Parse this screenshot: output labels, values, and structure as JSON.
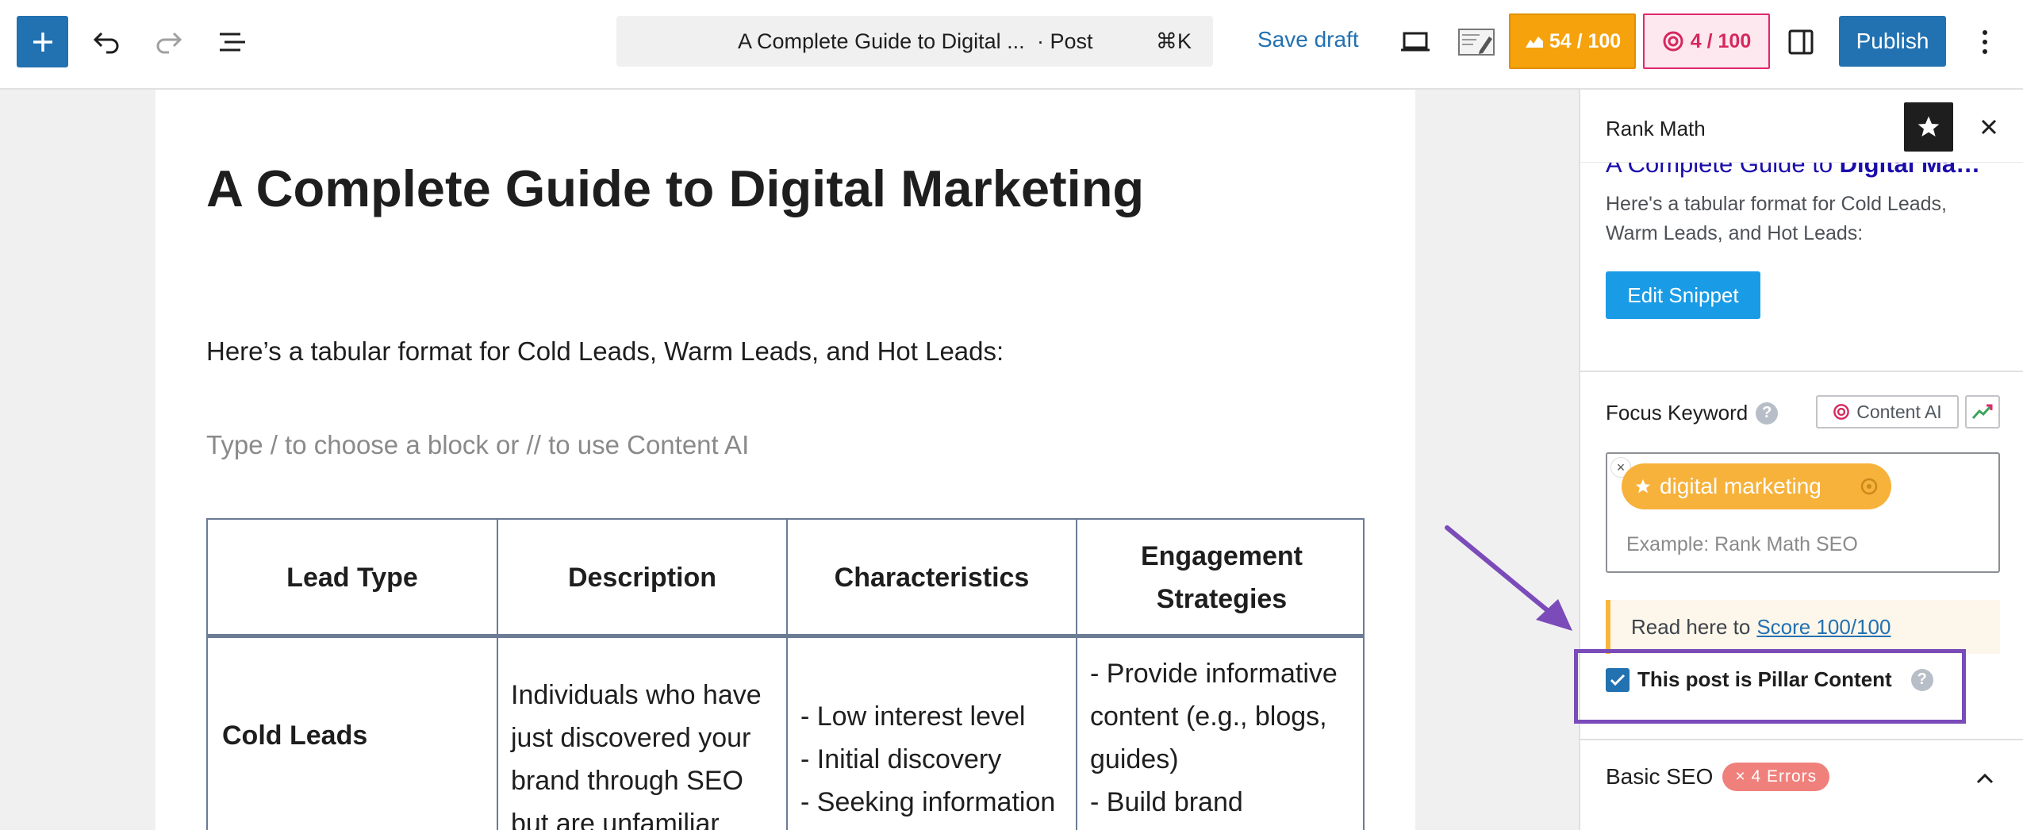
{
  "toolbar": {
    "post_title": "A Complete Guide to Digital ...",
    "post_type": "· Post",
    "shortcut": "⌘K",
    "save_draft": "Save draft",
    "seo_score": "54 / 100",
    "content_ai_score": "4 / 100",
    "publish": "Publish"
  },
  "editor": {
    "title": "A Complete Guide to Digital Marketing",
    "paragraph": "Here’s a tabular format for Cold Leads, Warm Leads, and Hot Leads:",
    "placeholder": "Type / to choose a block or // to use Content AI",
    "table": {
      "headers": [
        "Lead Type",
        "Description",
        "Characteristics",
        "Engagement Strategies"
      ],
      "row1": {
        "lead_type": "Cold Leads",
        "description": [
          "Individuals who have",
          "just discovered your",
          "brand through SEO",
          "but are unfamiliar"
        ],
        "characteristics": [
          "- Low interest level",
          "- Initial discovery",
          "- Seeking information"
        ],
        "strategies": [
          "- Provide informative",
          "content (e.g., blogs,",
          "guides)",
          "- Build brand"
        ]
      }
    }
  },
  "sidebar": {
    "title": "Rank Math",
    "snippet_title_plain": "A Complete Guide to ",
    "snippet_title_bold": "Digital Ma…",
    "snippet_desc": "Here's a tabular format for Cold Leads, Warm Leads, and Hot Leads:",
    "edit_snippet": "Edit Snippet",
    "focus_keyword_label": "Focus Keyword",
    "content_ai_btn": "Content AI",
    "keyword": "digital marketing",
    "keyword_placeholder": "Example: Rank Math SEO",
    "score_tip_text": "Read here to",
    "score_tip_link": "Score 100/100",
    "pillar_label": "This post is Pillar Content",
    "basic_seo": "Basic SEO",
    "errors_badge": "× 4 Errors"
  },
  "colors": {
    "accent": "#2271b1",
    "score_orange": "#f6a20c",
    "score_pink": "#e0286d",
    "annotation": "#7a4bb9"
  }
}
